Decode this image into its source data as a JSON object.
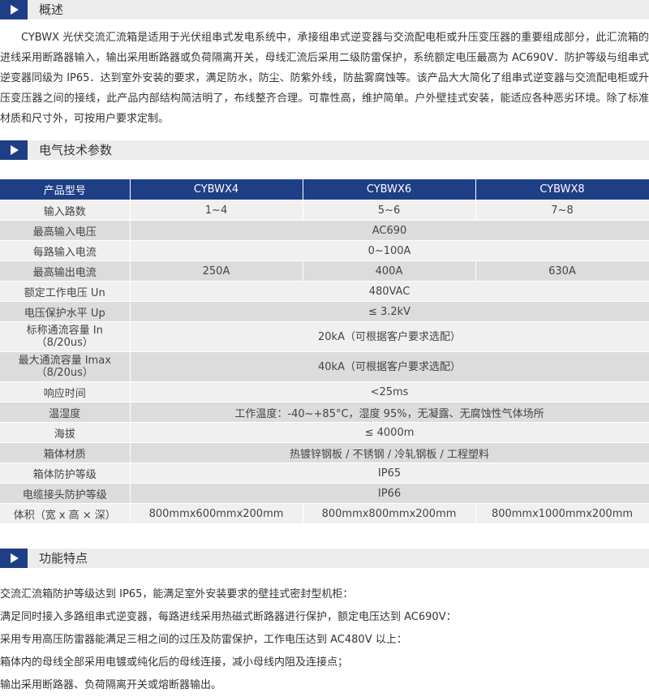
{
  "sections": {
    "overview": "概述",
    "specs": "电气技术参数",
    "features": "功能特点"
  },
  "overview_text": "CYBWX 光伏交流汇流箱是适用于光伏组串式发电系统中，承接组串式逆变器与交流配电柜或升压变压器的重要组成部分，此汇流箱的进线采用断路器输入，输出采用断路器或负荷隔离开关，母线汇流后采用二级防雷保护，系统额定电压最高为 AC690V．防护等级与组串式逆变器同级为 IP65．达到室外安装的要求，满足防水，防尘、防紫外线，防盐雾腐蚀等。该产品大大简化了组串式逆变器与交流配电柜或升压变压器之间的接线，此产品内部结构简洁明了，布线整齐合理。可靠性高，维护简单。户外壁挂式安装，能适应各种恶劣环境。除了标准材质和尺寸外，可按用户要求定制。",
  "table": {
    "header": [
      "产品型号",
      "CYBWX4",
      "CYBWX6",
      "CYBWX8"
    ],
    "rows": [
      {
        "label": "输入路数",
        "cells": [
          "1~4",
          "5~6",
          "7~8"
        ]
      },
      {
        "label": "最高输入电压",
        "cells": [
          "AC690"
        ]
      },
      {
        "label": "每路输入电流",
        "cells": [
          "0~100A"
        ]
      },
      {
        "label": "最高输出电流",
        "cells": [
          "250A",
          "400A",
          "630A"
        ]
      },
      {
        "label": "额定工作电压 Un",
        "cells": [
          "480VAC"
        ]
      },
      {
        "label": "电压保护水平 Up",
        "cells": [
          "≤ 3.2kV"
        ]
      },
      {
        "label": "标称通流容量 In\n（8/20us）",
        "cells": [
          "20kA（可根据客户要求选配）"
        ]
      },
      {
        "label": "最大通流容量 Imax\n（8/20us）",
        "cells": [
          "40kA（可根据客户要求选配）"
        ]
      },
      {
        "label": "响应时间",
        "cells": [
          "<25ms"
        ]
      },
      {
        "label": "温湿度",
        "cells": [
          "工作温度：-40~+85°C，湿度 95%，无凝露、无腐蚀性气体场所"
        ]
      },
      {
        "label": "海拔",
        "cells": [
          "≤ 4000m"
        ]
      },
      {
        "label": "箱体材质",
        "cells": [
          "热镀锌钢板 / 不锈钢 / 冷轧钢板 / 工程塑料"
        ]
      },
      {
        "label": "箱体防护等级",
        "cells": [
          "IP65"
        ]
      },
      {
        "label": "电缆接头防护等级",
        "cells": [
          "IP66"
        ]
      },
      {
        "label": "体积（宽 x 高 × 深）",
        "cells": [
          "800mmx600mmx200mm",
          "800mmx800mmx200mm",
          "800mmx1000mmx200mm"
        ]
      }
    ]
  },
  "features": [
    "交流汇流箱防护等级达到 IP65，能满足室外安装要求的壁挂式密封型机柜：",
    "满足同时接入多路组串式逆变器，每路进线采用热磁式断路器进行保护，额定电压达到 AC690V：",
    "采用专用高压防雷器能满足三相之间的过压及防雷保护，工作电压达到 AC480V 以上：",
    "箱体内的母线全部采用电镀或纯化后的母线连接，减小母线内阻及连接点；",
    "输出采用断路器、负荷隔离开关或熔断器输出。"
  ],
  "colors": {
    "accent": "#1e3e86",
    "section_bg": "#ececec",
    "row_light": "#f0f0f0",
    "row_dark": "#dcdcdc"
  }
}
